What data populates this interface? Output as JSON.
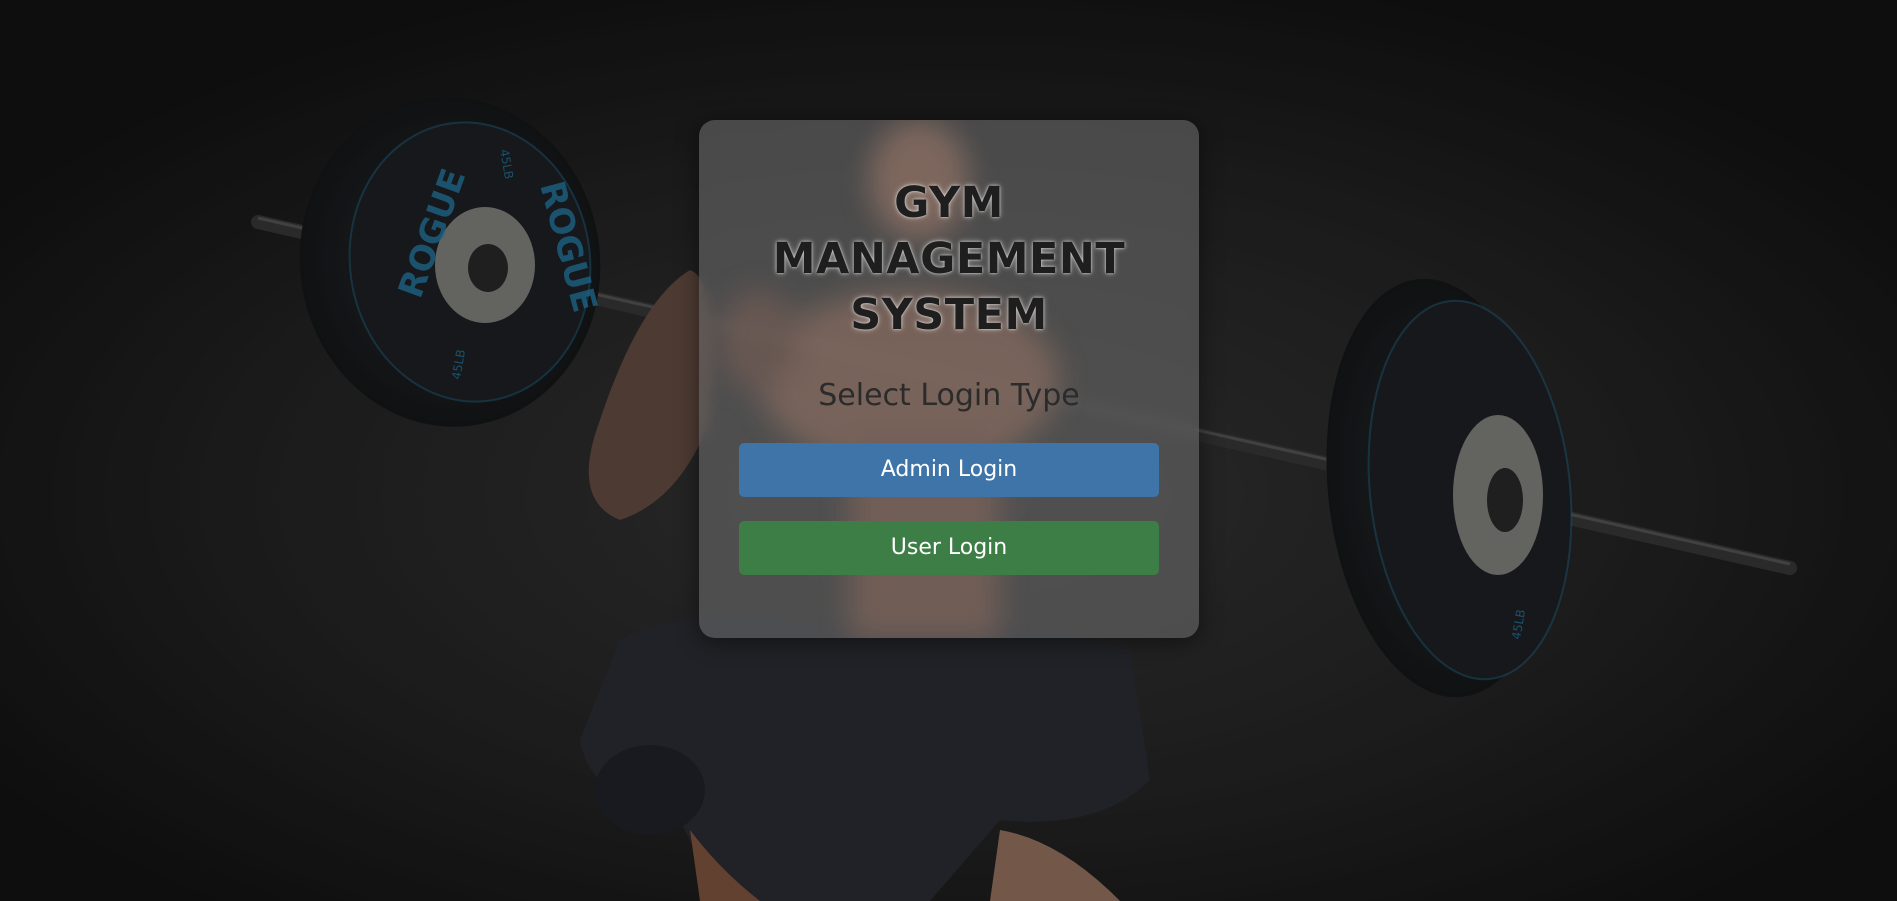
{
  "colors": {
    "page_background": "#141414",
    "card_background": "#6a6a6a",
    "admin_button": "#3f74a8",
    "user_button": "#3d7d46",
    "plate_accent": "#2a8fc0"
  },
  "background": {
    "plate_label_left": "ROGUE",
    "plate_label_right": "ROGUE",
    "plate_weight_left_top": "45LB",
    "plate_weight_left_bottom": "45LB",
    "plate_weight_right_bottom": "45LB"
  },
  "card": {
    "title_line1": "GYM",
    "title_line2": "MANAGEMENT",
    "title_line3": "SYSTEM",
    "subtitle": "Select Login Type",
    "admin_button_label": "Admin Login",
    "user_button_label": "User Login"
  }
}
